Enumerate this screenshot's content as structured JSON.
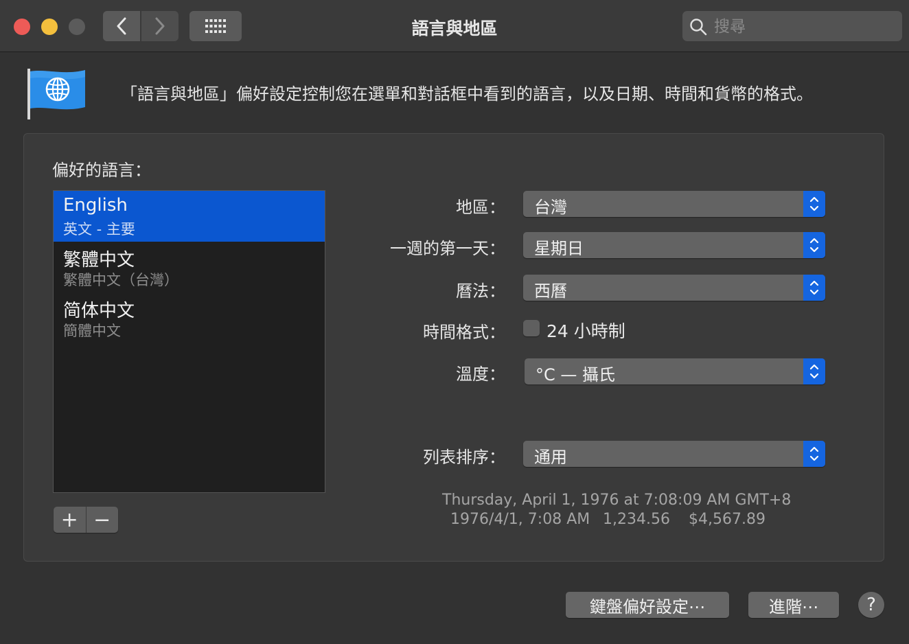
{
  "window": {
    "title": "語言與地區"
  },
  "search": {
    "placeholder": "搜尋"
  },
  "header": {
    "description": "「語言與地區」偏好設定控制您在選單和對話框中看到的語言，以及日期、時間和貨幣的格式。"
  },
  "preferred_languages": {
    "title": "偏好的語言：",
    "items": [
      {
        "name": "English",
        "sub": "英文 - 主要",
        "selected": true
      },
      {
        "name": "繁體中文",
        "sub": "繁體中文（台灣）",
        "selected": false
      },
      {
        "name": "简体中文",
        "sub": "簡體中文",
        "selected": false
      }
    ],
    "add_label": "+",
    "remove_label": "−"
  },
  "settings": {
    "region": {
      "label": "地區：",
      "value": "台灣"
    },
    "first_day": {
      "label": "一週的第一天：",
      "value": "星期日"
    },
    "calendar": {
      "label": "曆法：",
      "value": "西曆"
    },
    "time_format": {
      "label": "時間格式：",
      "checkbox_label": "24 小時制",
      "checked": false
    },
    "temperature": {
      "label": "溫度：",
      "value": "°C — 攝氏"
    },
    "list_sort": {
      "label": "列表排序：",
      "value": "通用"
    }
  },
  "sample": {
    "line1": "Thursday, April 1, 1976 at 7:08:09 AM GMT+8",
    "date_short": "1976/4/1, 7:08 AM",
    "number": "1,234.56",
    "currency": "$4,567.89"
  },
  "buttons": {
    "keyboard_prefs": "鍵盤偏好設定⋯",
    "advanced": "進階⋯",
    "help": "?"
  },
  "colors": {
    "accent": "#0b57d0",
    "popup_arrow": "#1565e0"
  },
  "icons": [
    "chevron-left-icon",
    "chevron-right-icon",
    "grid-icon",
    "search-icon",
    "flag-globe-icon",
    "updown-chevron-icon"
  ]
}
